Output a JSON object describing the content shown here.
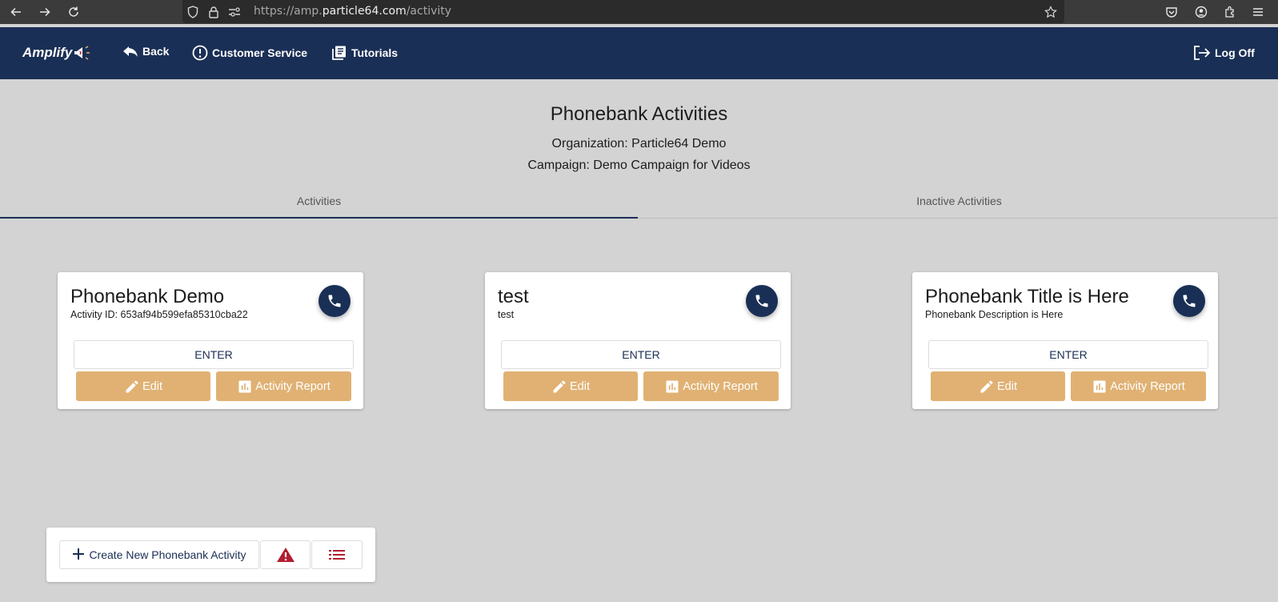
{
  "browser": {
    "url_prefix": "https://amp.",
    "url_domain": "particle64.com",
    "url_path": "/activity"
  },
  "header": {
    "logo_text": "Amplify",
    "back_label": "Back",
    "customer_service_label": "Customer Service",
    "tutorials_label": "Tutorials",
    "log_off_label": "Log Off"
  },
  "page": {
    "title": "Phonebank Activities",
    "organization": "Organization: Particle64 Demo",
    "campaign": "Campaign: Demo Campaign for Videos"
  },
  "tabs": [
    {
      "label": "Activities",
      "active": true
    },
    {
      "label": "Inactive Activities",
      "active": false
    }
  ],
  "cards": [
    {
      "title": "Phonebank Demo",
      "description": "Activity ID: 653af94b599efa85310cba22",
      "enter_label": "ENTER",
      "edit_label": "Edit",
      "report_label": "Activity Report"
    },
    {
      "title": "test",
      "description": "test",
      "enter_label": "ENTER",
      "edit_label": "Edit",
      "report_label": "Activity Report"
    },
    {
      "title": "Phonebank Title is Here",
      "description": "Phonebank Description is Here",
      "enter_label": "ENTER",
      "edit_label": "Edit",
      "report_label": "Activity Report"
    }
  ],
  "toolbar": {
    "create_label": "Create New Phonebank Activity"
  },
  "colors": {
    "primary": "#1a2f55",
    "accent": "#e0b173",
    "alert": "#b01e2f",
    "background": "#d3d3d3"
  }
}
